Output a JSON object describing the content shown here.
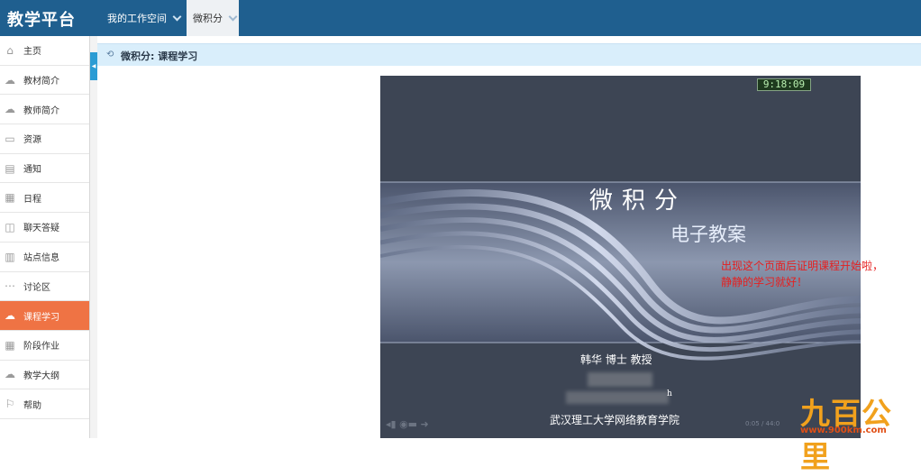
{
  "app": {
    "title": "教学平台"
  },
  "topnav": {
    "workspace_label": "我的工作空间",
    "course_label": "微积分"
  },
  "sidebar": {
    "items": [
      {
        "label": "主页",
        "icon": "home-icon"
      },
      {
        "label": "教材简介",
        "icon": "cloud-upload-icon"
      },
      {
        "label": "教师简介",
        "icon": "cloud-upload-icon"
      },
      {
        "label": "资源",
        "icon": "folder-icon"
      },
      {
        "label": "通知",
        "icon": "comment-icon"
      },
      {
        "label": "日程",
        "icon": "calendar-icon"
      },
      {
        "label": "聊天答疑",
        "icon": "chat-icon"
      },
      {
        "label": "站点信息",
        "icon": "document-icon"
      },
      {
        "label": "讨论区",
        "icon": "discussion-icon"
      },
      {
        "label": "课程学习",
        "icon": "cloud-icon",
        "active": true
      },
      {
        "label": "阶段作业",
        "icon": "assignment-icon"
      },
      {
        "label": "教学大纲",
        "icon": "cloud-upload-icon"
      },
      {
        "label": "帮助",
        "icon": "flag-icon"
      }
    ]
  },
  "breadcrumb": {
    "text": "微积分: 课程学习"
  },
  "video": {
    "timer": "9:18:09",
    "title": "微积分",
    "subtitle": "电子教案",
    "lecturer": "韩华 博士 教授",
    "small_text": "h",
    "school": "武汉理工大学网络教育学院",
    "time_display": "0:05 / 44:0"
  },
  "note": {
    "line1": "出现这个页面后证明课程开始啦，",
    "line2": "静静的学习就好！"
  },
  "watermark": {
    "logo": "九百公里",
    "url": "www.900km.com"
  },
  "colors": {
    "topbar": "#1f5f8f",
    "active": "#ef7344",
    "breadcrumb": "#d9eefb",
    "video_bg": "#3d4554",
    "note": "#e52020",
    "logo": "#f1a11d"
  }
}
